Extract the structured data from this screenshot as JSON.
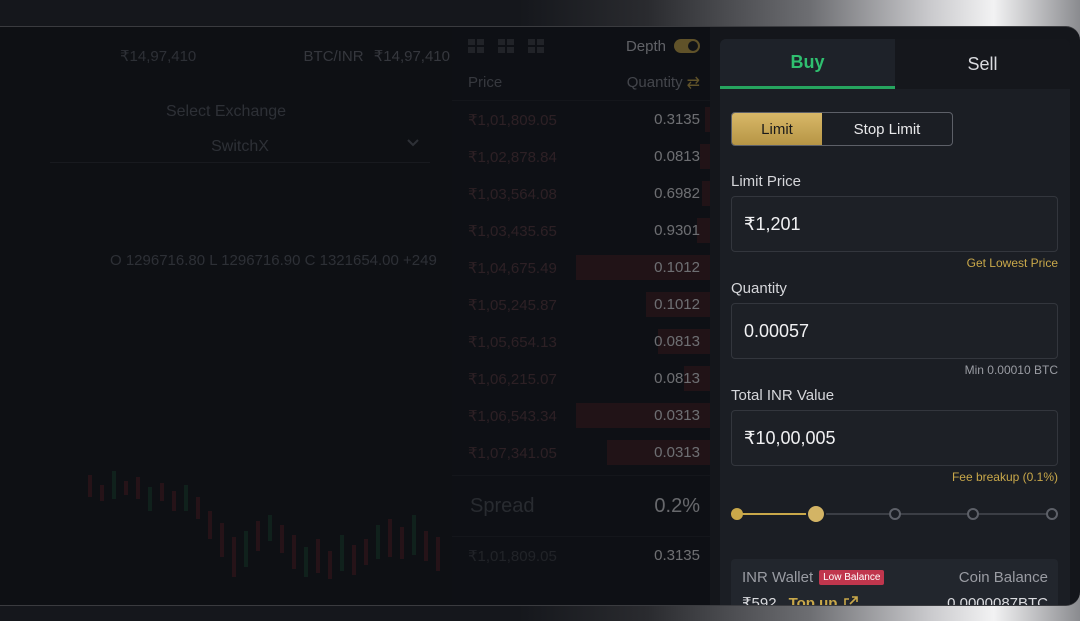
{
  "chart_pane": {
    "ticker_left": "₹14,97,410",
    "pair": "BTC/INR",
    "ticker_price": "₹14,97,410",
    "exchange_label": "Select Exchange",
    "exchange_value": "SwitchX",
    "ohlc": "O 1296716.80  L 1296716.90  C 1321654.00  +249"
  },
  "order_book": {
    "depth_label": "Depth",
    "price_header": "Price",
    "quantity_header": "Quantity",
    "rows": [
      {
        "price": "₹1,01,809.05",
        "qty": "0.3135",
        "depth": 0.02
      },
      {
        "price": "₹1,02,878.84",
        "qty": "0.0813",
        "depth": 0.04
      },
      {
        "price": "₹1,03,564.08",
        "qty": "0.6982",
        "depth": 0.03
      },
      {
        "price": "₹1,03,435.65",
        "qty": "0.9301",
        "depth": 0.05
      },
      {
        "price": "₹1,04,675.49",
        "qty": "0.1012",
        "depth": 0.52
      },
      {
        "price": "₹1,05,245.87",
        "qty": "0.1012",
        "depth": 0.25
      },
      {
        "price": "₹1,05,654.13",
        "qty": "0.0813",
        "depth": 0.2
      },
      {
        "price": "₹1,06,215.07",
        "qty": "0.0813",
        "depth": 0.1
      },
      {
        "price": "₹1,06,543.34",
        "qty": "0.0313",
        "depth": 0.52
      },
      {
        "price": "₹1,07,341.05",
        "qty": "0.0313",
        "depth": 0.4
      }
    ],
    "spread_label": "Spread",
    "spread_value": "0.2%",
    "tail_price": "₹1,01,809.05",
    "tail_qty": "0.3135"
  },
  "trade": {
    "buy_tab": "Buy",
    "sell_tab": "Sell",
    "limit_label": "Limit",
    "stop_limit_label": "Stop Limit",
    "limit_price_label": "Limit Price",
    "limit_price_value": "₹1,201",
    "get_lowest_price": "Get Lowest Price",
    "quantity_label": "Quantity",
    "quantity_value": "0.00057",
    "min_quantity": "Min 0.00010 BTC",
    "total_label": "Total INR Value",
    "total_value": "₹10,00,005",
    "fee_breakup": "Fee breakup (0.1%)",
    "slider_fraction": 0.25
  },
  "wallet": {
    "inr_label": "INR Wallet",
    "low_balance": "Low Balance",
    "coin_label": "Coin Balance",
    "inr_value": "₹592",
    "top_up": "Top up",
    "coin_value": "0.0000087BTC"
  },
  "colors": {
    "accent_gold": "#c9a84a",
    "buy_green": "#2fbf6f",
    "ask_red": "#8c2832",
    "badge_red": "#c0364d"
  }
}
